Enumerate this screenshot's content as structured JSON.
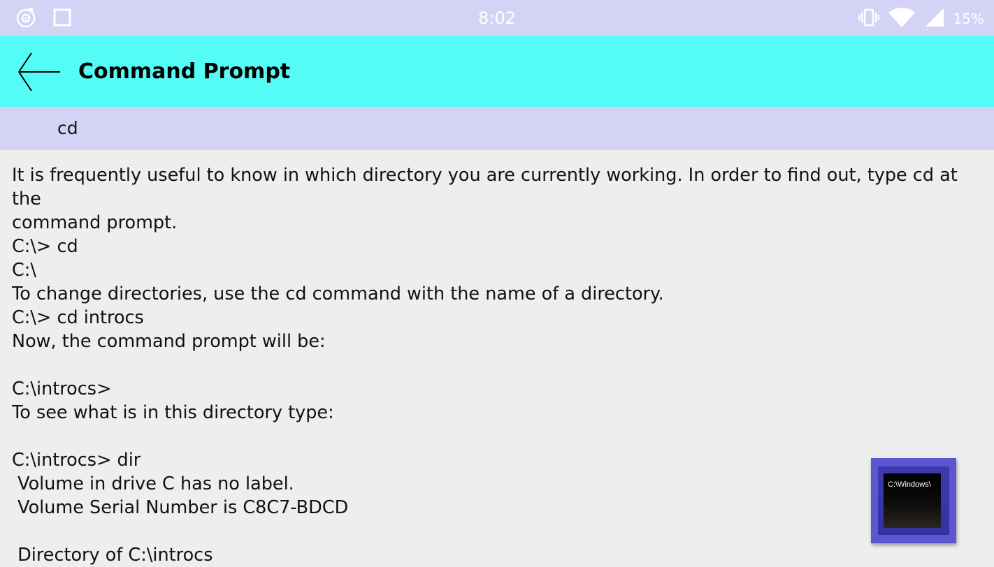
{
  "status_bar": {
    "time": "8:02",
    "battery_percent": "15%",
    "icons": [
      "music-app-icon",
      "square-icon",
      "vibrate-icon",
      "wifi-icon",
      "signal-icon"
    ]
  },
  "app_bar": {
    "title": "Command Prompt",
    "back_icon": "back-arrow-icon",
    "background_color": "#55fbf5"
  },
  "section": {
    "title": "cd"
  },
  "content": {
    "lines": [
      "It is frequently useful to know in which directory you are currently working. In order to find out, type cd at the",
      "command prompt.",
      "C:\\> cd",
      "C:\\",
      "To change directories, use the cd command with the name of a directory.",
      "C:\\> cd introcs",
      "Now, the command prompt will be:",
      "",
      "C:\\introcs>",
      "To see what is in this directory type:",
      "",
      "C:\\introcs> dir",
      " Volume in drive C has no label.",
      " Volume Serial Number is C8C7-BDCD",
      "",
      " Directory of C:\\introcs"
    ]
  },
  "fab": {
    "label": "C:\\Windows\\",
    "icon": "command-prompt-icon"
  }
}
